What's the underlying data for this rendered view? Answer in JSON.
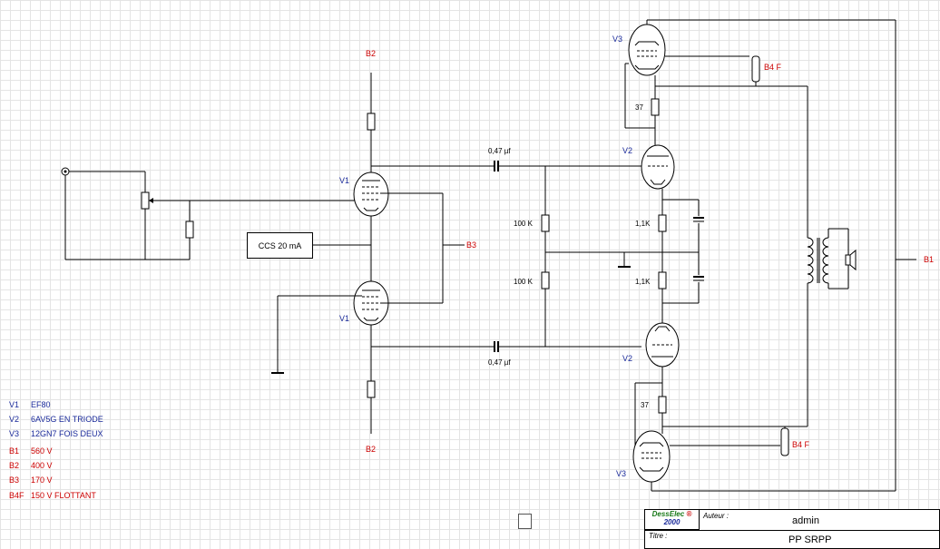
{
  "labels": {
    "b2_top": "B2",
    "b2_bottom": "B2",
    "b3": "B3",
    "b1": "B1",
    "b4f_top": "B4 F",
    "b4f_bottom": "B4 F",
    "v1_top": "V1",
    "v1_bottom": "V1",
    "v2_top": "V2",
    "v2_bottom": "V2",
    "v3_top": "V3",
    "v3_bottom": "V3",
    "cap_top": "0,47 µf",
    "cap_bottom": "0,47 µf",
    "r100k_top": "100 K",
    "r100k_bottom": "100 K",
    "r11k_top": "1,1K",
    "r11k_bottom": "1,1K",
    "r37_top": "37",
    "r37_bottom": "37",
    "ccs": "CCS 20 mA"
  },
  "legend": {
    "tubes": [
      {
        "key": "V1",
        "value": "EF80"
      },
      {
        "key": "V2",
        "value": "6AV5G EN TRIODE"
      },
      {
        "key": "V3",
        "value": "12GN7 FOIS DEUX"
      }
    ],
    "supplies": [
      {
        "key": "B1",
        "value": "560 V"
      },
      {
        "key": "B2",
        "value": "400 V"
      },
      {
        "key": "B3",
        "value": "170 V"
      },
      {
        "key": "B4F",
        "value": "150 V FLOTTANT"
      }
    ]
  },
  "title_block": {
    "logo_line1": "DessElec",
    "logo_mark": "®",
    "logo_line2": "2000",
    "author_label": "Auteur :",
    "author_value": "admin",
    "title_label": "Titre :",
    "title_value": "PP SRPP"
  },
  "colors": {
    "supply_label": "#cc0000",
    "tube_label": "#1a2a9a",
    "grid": "#e4e4e4"
  }
}
